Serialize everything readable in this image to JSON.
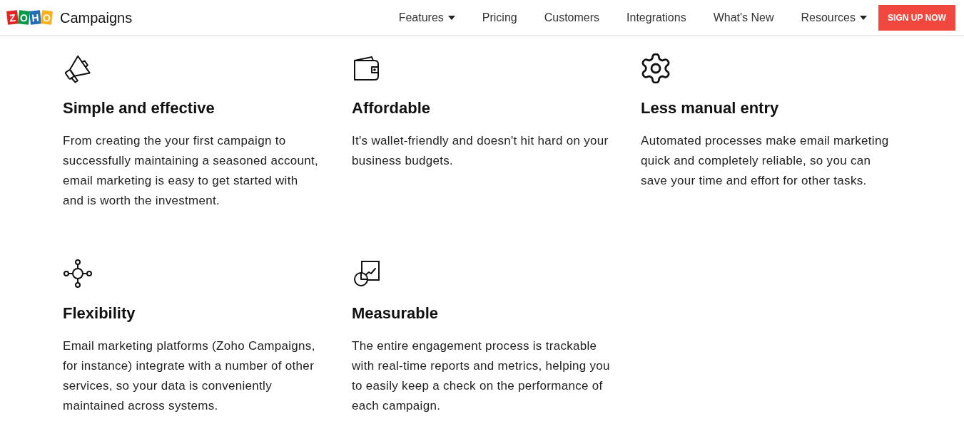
{
  "header": {
    "logo": {
      "letters": [
        {
          "char": "Z",
          "color": "#e42527"
        },
        {
          "char": "O",
          "color": "#089949"
        },
        {
          "char": "H",
          "color": "#226db4"
        },
        {
          "char": "O",
          "color": "#f9b21d"
        }
      ],
      "product": "Campaigns"
    },
    "nav": [
      {
        "label": "Features",
        "has_menu": true
      },
      {
        "label": "Pricing",
        "has_menu": false
      },
      {
        "label": "Customers",
        "has_menu": false
      },
      {
        "label": "Integrations",
        "has_menu": false
      },
      {
        "label": "What's New",
        "has_menu": false
      },
      {
        "label": "Resources",
        "has_menu": true
      }
    ],
    "cta": "SIGN UP NOW"
  },
  "features": [
    {
      "kind": "megaphone",
      "title": "Simple and effective",
      "text": "From creating the your first campaign to successfully maintaining a seasoned account, email marketing is easy to get started with and is worth the investment."
    },
    {
      "kind": "wallet",
      "title": "Affordable",
      "text": "It's wallet-friendly and doesn't hit hard on your business budgets."
    },
    {
      "kind": "gear",
      "title": "Less manual entry",
      "text": "Automated processes make email marketing quick and completely reliable, so you can save your time and effort for other tasks."
    },
    {
      "kind": "hub",
      "title": "Flexibility",
      "text": "Email marketing platforms (Zoho Campaigns, for instance) integrate with a number of other services, so your data is conveniently maintained across systems."
    },
    {
      "kind": "chart",
      "title": "Measurable",
      "text": "The entire engagement process is trackable with real-time reports and metrics, helping you to easily keep a check on the performance of each campaign."
    }
  ]
}
